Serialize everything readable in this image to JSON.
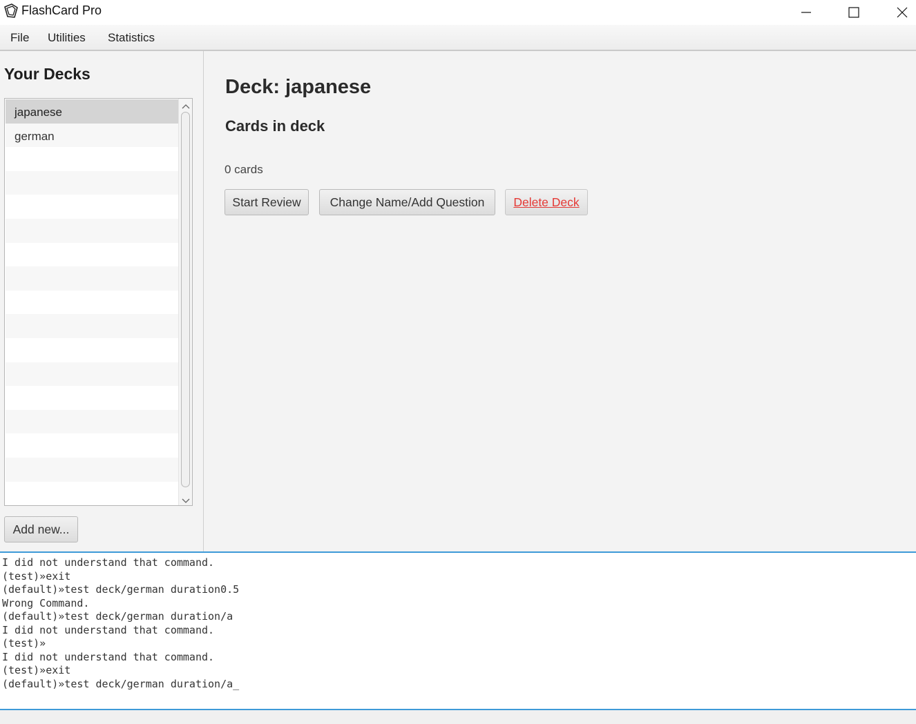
{
  "window": {
    "title": "FlashCard Pro",
    "icons": {
      "app": "flashcard-icon",
      "minimize": "minimize-icon",
      "maximize": "maximize-icon",
      "close": "close-icon"
    }
  },
  "menubar": {
    "items": [
      "File",
      "Utilities",
      "Statistics"
    ]
  },
  "sidebar": {
    "heading": "Your Decks",
    "decks": [
      "japanese",
      "german"
    ],
    "selected_deck": "japanese",
    "add_button_label": "Add new..."
  },
  "main": {
    "deck_title": "Deck: japanese",
    "cards_heading": "Cards in deck",
    "card_count": "0 cards",
    "buttons": {
      "start_review": "Start Review",
      "change_name": "Change Name/Add Question",
      "delete_deck": "Delete Deck"
    }
  },
  "console": {
    "lines": [
      "I did not understand that command.",
      "(test)»exit",
      "(default)»test deck/german duration0.5",
      "Wrong Command.",
      "(default)»test deck/german duration/a",
      "I did not understand that command.",
      "(test)»",
      "I did not understand that command.",
      "(test)»exit",
      "(default)»test deck/german duration/a_"
    ]
  },
  "colors": {
    "accent": "#3d9ad8",
    "danger": "#e53935",
    "selection": "#d4d4d4"
  }
}
